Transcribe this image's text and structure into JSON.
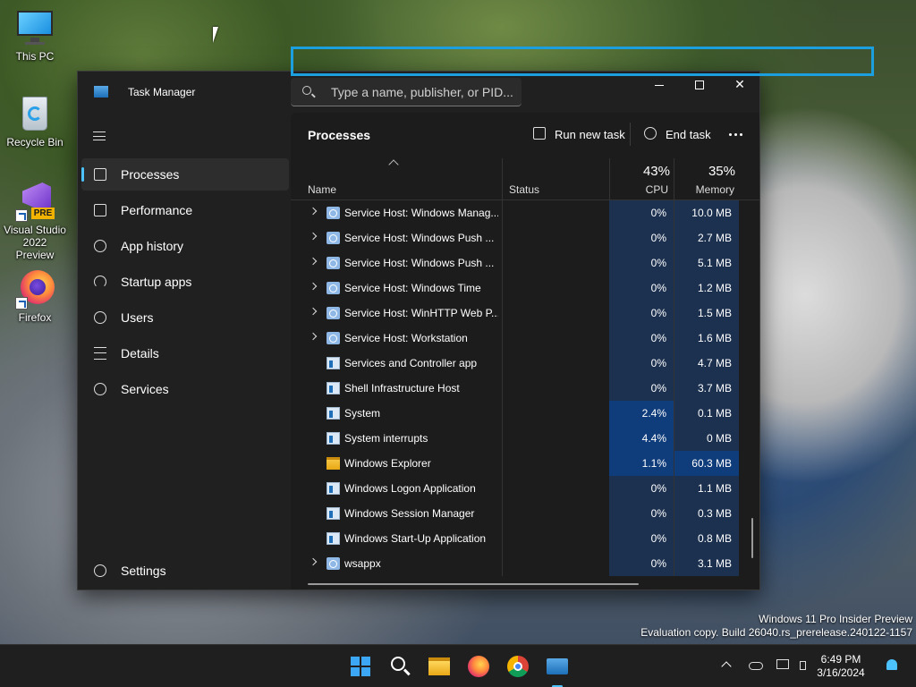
{
  "desktop": {
    "icons": [
      {
        "label": "This PC"
      },
      {
        "label": "Recycle Bin"
      },
      {
        "label": "Visual Studio 2022 Preview",
        "line1": "Visual Studio",
        "line2": "2022 Preview",
        "badge": "PRE"
      },
      {
        "label": "Firefox"
      }
    ],
    "watermark": {
      "line1": "Windows 11 Pro Insider Preview",
      "line2": "Evaluation copy. Build 26040.rs_prerelease.240122-1157"
    }
  },
  "window": {
    "title": "Task Manager",
    "search_placeholder": "Type a name, publisher, or PID...",
    "close_glyph": "✕"
  },
  "sidebar": {
    "items": [
      {
        "label": "Processes",
        "icon": "processes-icon",
        "active": true
      },
      {
        "label": "Performance",
        "icon": "performance-icon"
      },
      {
        "label": "App history",
        "icon": "history-icon"
      },
      {
        "label": "Startup apps",
        "icon": "startup-icon"
      },
      {
        "label": "Users",
        "icon": "users-icon"
      },
      {
        "label": "Details",
        "icon": "details-icon"
      },
      {
        "label": "Services",
        "icon": "services-icon"
      }
    ],
    "settings_label": "Settings"
  },
  "main": {
    "title": "Processes",
    "run_new_task": "Run new task",
    "end_task": "End task",
    "columns": {
      "name": "Name",
      "status": "Status",
      "cpu_total": "43%",
      "cpu": "CPU",
      "memory_total": "35%",
      "memory": "Memory"
    },
    "rows": [
      {
        "name": "Service Host: Windows Manag...",
        "cpu": "0%",
        "memory": "10.0 MB",
        "expandable": true,
        "icon": "gear"
      },
      {
        "name": "Service Host: Windows Push ...",
        "cpu": "0%",
        "memory": "2.7 MB",
        "expandable": true,
        "icon": "gear"
      },
      {
        "name": "Service Host: Windows Push ...",
        "cpu": "0%",
        "memory": "5.1 MB",
        "expandable": true,
        "icon": "gear"
      },
      {
        "name": "Service Host: Windows Time",
        "cpu": "0%",
        "memory": "1.2 MB",
        "expandable": true,
        "icon": "gear"
      },
      {
        "name": "Service Host: WinHTTP Web P...",
        "cpu": "0%",
        "memory": "1.5 MB",
        "expandable": true,
        "icon": "gear"
      },
      {
        "name": "Service Host: Workstation",
        "cpu": "0%",
        "memory": "1.6 MB",
        "expandable": true,
        "icon": "gear"
      },
      {
        "name": "Services and Controller app",
        "cpu": "0%",
        "memory": "4.7 MB",
        "expandable": false,
        "icon": "app"
      },
      {
        "name": "Shell Infrastructure Host",
        "cpu": "0%",
        "memory": "3.7 MB",
        "expandable": false,
        "icon": "app"
      },
      {
        "name": "System",
        "cpu": "2.4%",
        "memory": "0.1 MB",
        "expandable": false,
        "icon": "app",
        "cpu_hot": true
      },
      {
        "name": "System interrupts",
        "cpu": "4.4%",
        "memory": "0 MB",
        "expandable": false,
        "icon": "app",
        "cpu_hot": true
      },
      {
        "name": "Windows Explorer",
        "cpu": "1.1%",
        "memory": "60.3 MB",
        "expandable": false,
        "icon": "folder",
        "cpu_hot": true,
        "mem_hot": true
      },
      {
        "name": "Windows Logon Application",
        "cpu": "0%",
        "memory": "1.1 MB",
        "expandable": false,
        "icon": "app"
      },
      {
        "name": "Windows Session Manager",
        "cpu": "0%",
        "memory": "0.3 MB",
        "expandable": false,
        "icon": "app"
      },
      {
        "name": "Windows Start-Up Application",
        "cpu": "0%",
        "memory": "0.8 MB",
        "expandable": false,
        "icon": "app"
      },
      {
        "name": "wsappx",
        "cpu": "0%",
        "memory": "3.1 MB",
        "expandable": true,
        "icon": "gear"
      }
    ]
  },
  "taskbar": {
    "apps": [
      "start-icon",
      "search-icon",
      "file-explorer-icon",
      "firefox-icon",
      "chrome-icon",
      "task-manager-icon"
    ],
    "time": "6:49 PM",
    "date": "3/16/2024"
  },
  "colors": {
    "accent": "#4cc2ff",
    "highlight_box": "#1b9fde",
    "cpu_cell": "#1c3150",
    "cpu_cell_hot": "#0f3c7a"
  }
}
